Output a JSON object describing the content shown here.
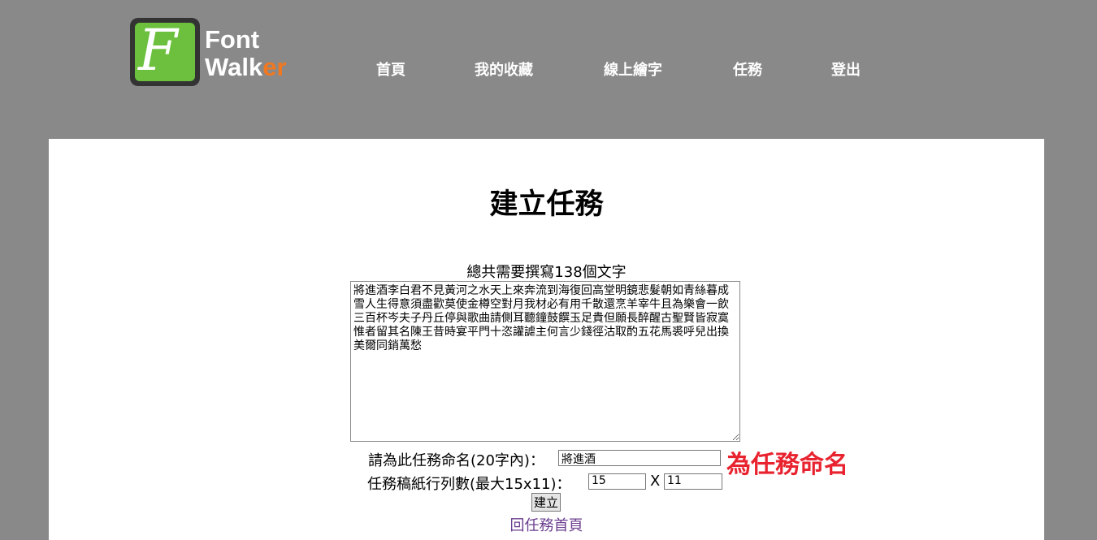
{
  "header": {
    "logo_text_line1": "Font",
    "logo_text_line2a": "Walk",
    "logo_text_line2b": "er",
    "nav": [
      {
        "label": "首頁"
      },
      {
        "label": "我的收藏"
      },
      {
        "label": "線上繪字"
      },
      {
        "label": "任務"
      },
      {
        "label": "登出"
      }
    ]
  },
  "main": {
    "title": "建立任務",
    "total_text": "總共需要撰寫138個文字",
    "characters": "將進酒李白君不見黃河之水天上來奔流到海復回高堂明鏡悲髮朝如青絲暮成雪人生得意須盡歡莫使金樽空對月我材必有用千散還烹羊宰牛且為樂會一飲三百杯岑夫子丹丘停與歌曲請側耳聽鐘鼓饌玉足貴但願長醉醒古聖賢皆寂寞惟者留其名陳王昔時宴平門十恣讙謔主何言少錢徑沽取酌五花馬裘呼兒出換美爾同銷萬愁",
    "name_label": "請為此任務命名(20字內)：",
    "name_value": "將進酒",
    "annotation": "為任務命名",
    "grid_label": "任務稿紙行列數(最大15x11)：",
    "rows_value": "15",
    "x_sep": "X",
    "cols_value": "11",
    "create_button": "建立",
    "back_link": "回任務首頁"
  },
  "colors": {
    "background": "#898989",
    "panel": "#ffffff",
    "annotation": "#e8232f",
    "link": "#6a3d8f",
    "logo_green": "#6cc03d",
    "logo_orange": "#f07820"
  }
}
